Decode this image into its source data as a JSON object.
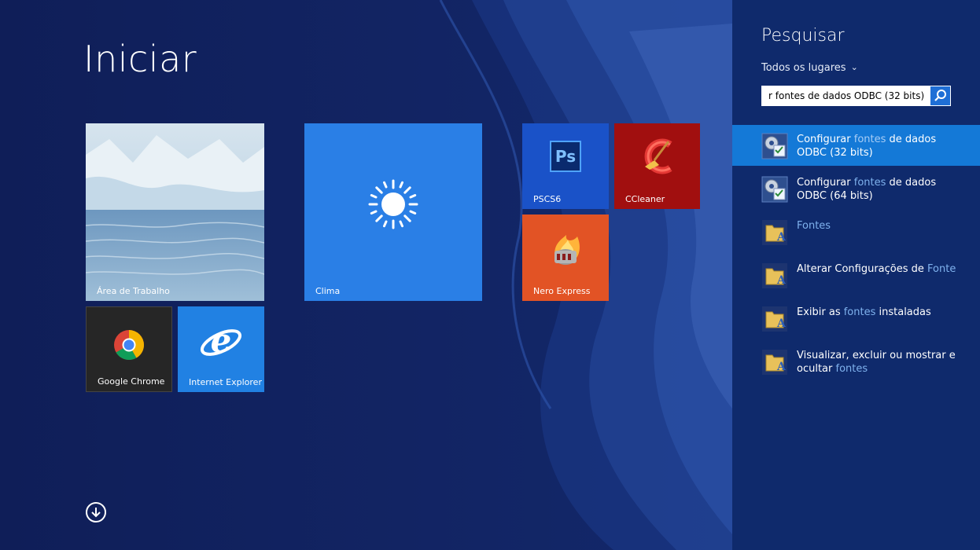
{
  "start": {
    "title": "Iniciar",
    "tiles": {
      "desktop": "Área de Trabalho",
      "chrome": "Google Chrome",
      "ie": "Internet Explorer",
      "clima": "Clima",
      "ps": "PSCS6",
      "cc": "CCleaner",
      "nero": "Nero Express"
    },
    "ps_icon_text": "Ps"
  },
  "search": {
    "title": "Pesquisar",
    "scope": "Todos os lugares",
    "query": "r fontes de dados ODBC (32 bits)",
    "results": [
      {
        "pre": "Configurar ",
        "hl": "fontes",
        "post": " de dados ODBC (32 bits)",
        "icon": "odbc-admin-icon",
        "selected": true
      },
      {
        "pre": "Configurar ",
        "hl": "fontes",
        "post": " de dados ODBC (64 bits)",
        "icon": "odbc-admin-icon"
      },
      {
        "pre": "",
        "hl": "Fontes",
        "post": "",
        "icon": "fonts-folder-icon"
      },
      {
        "pre": "Alterar Configurações de ",
        "hl": "Fonte",
        "post": "",
        "icon": "fonts-folder-icon"
      },
      {
        "pre": "Exibir as ",
        "hl": "fontes",
        "post": " instaladas",
        "icon": "fonts-folder-icon"
      },
      {
        "pre": "Visualizar, excluir ou mostrar e ocultar ",
        "hl": "fontes",
        "post": "",
        "icon": "fonts-folder-icon"
      }
    ]
  },
  "colors": {
    "background": "#0f1f5c",
    "search_pane": "#0f2a6c",
    "selected_result": "#1479d7",
    "highlight_text": "#7fb2ee"
  }
}
